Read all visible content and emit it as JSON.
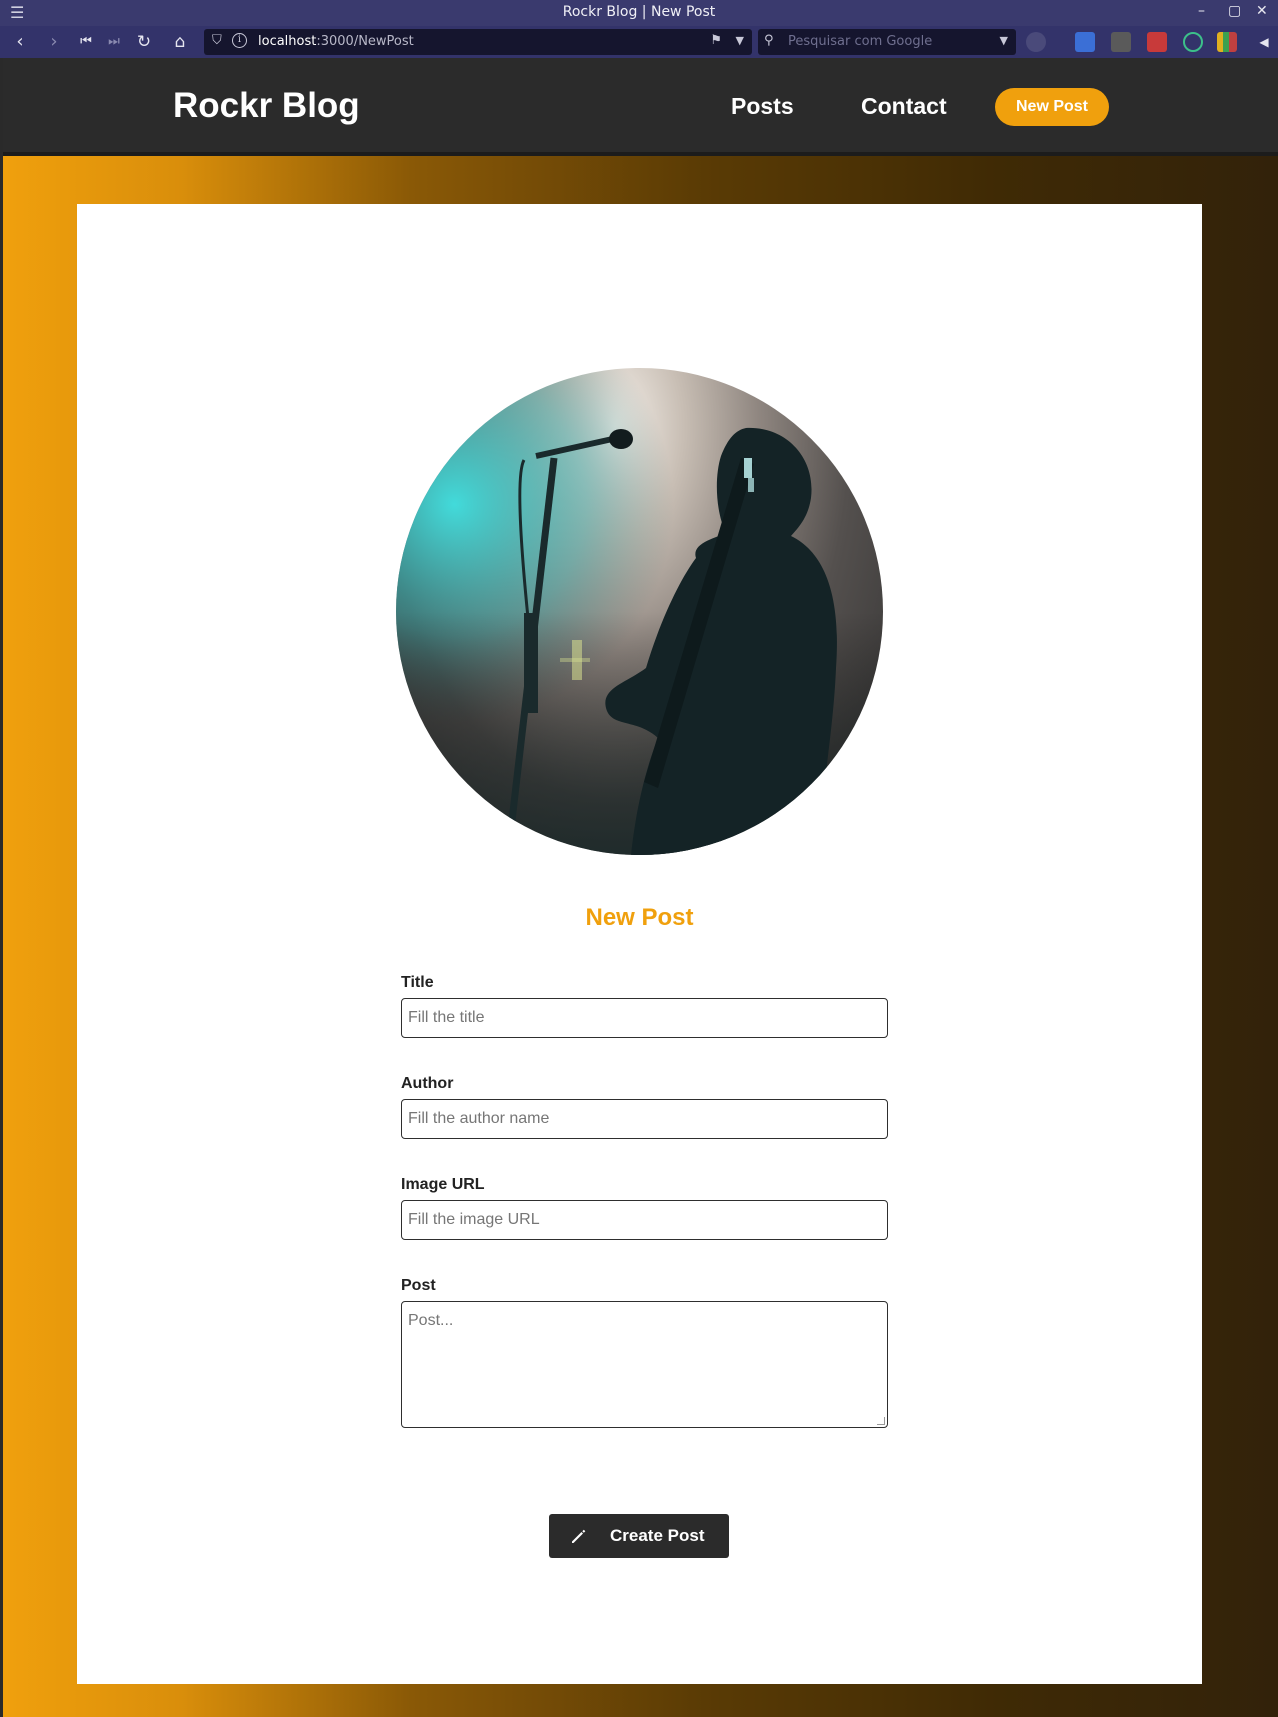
{
  "browser": {
    "window_title": "Rockr Blog | New Post",
    "url_host": "localhost",
    "url_rest": ":3000/NewPost",
    "search_placeholder": "Pesquisar com Google"
  },
  "header": {
    "logo": "Rockr Blog",
    "nav": [
      {
        "label": "Posts"
      },
      {
        "label": "Contact"
      }
    ],
    "cta_label": "New Post"
  },
  "form": {
    "title": "New Post",
    "fields": [
      {
        "label": "Title",
        "placeholder": "Fill the title"
      },
      {
        "label": "Author",
        "placeholder": "Fill the author name"
      },
      {
        "label": "Image URL",
        "placeholder": "Fill the image URL"
      },
      {
        "label": "Post",
        "placeholder": "Post..."
      }
    ],
    "submit_label": "Create Post"
  },
  "colors": {
    "accent": "#f0a00d",
    "header_bg": "#2b2b2b",
    "browser_bg": "#33336a"
  },
  "icons": [
    "menu-icon",
    "back-icon",
    "forward-icon",
    "first-icon",
    "last-icon",
    "reload-icon",
    "home-icon",
    "shield-icon",
    "info-icon",
    "bookmark-icon",
    "search-icon",
    "pencil-icon"
  ]
}
